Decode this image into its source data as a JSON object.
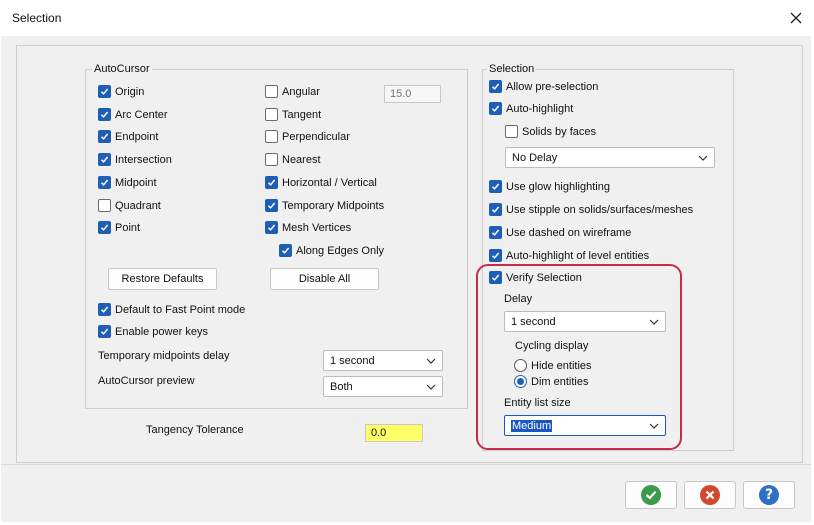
{
  "window": {
    "title": "Selection"
  },
  "autocursor": {
    "group_label": "AutoCursor",
    "col1": [
      {
        "label": "Origin",
        "checked": true
      },
      {
        "label": "Arc Center",
        "checked": true
      },
      {
        "label": "Endpoint",
        "checked": true
      },
      {
        "label": "Intersection",
        "checked": true
      },
      {
        "label": "Midpoint",
        "checked": true
      },
      {
        "label": "Quadrant",
        "checked": false
      },
      {
        "label": "Point",
        "checked": true
      }
    ],
    "col2": [
      {
        "label": "Angular",
        "checked": false
      },
      {
        "label": "Tangent",
        "checked": false
      },
      {
        "label": "Perpendicular",
        "checked": false
      },
      {
        "label": "Nearest",
        "checked": false
      },
      {
        "label": "Horizontal / Vertical",
        "checked": true
      },
      {
        "label": "Temporary Midpoints",
        "checked": true
      },
      {
        "label": "Mesh Vertices",
        "checked": true
      }
    ],
    "along_edges": {
      "label": "Along Edges Only",
      "checked": true
    },
    "angle_value": "15.0",
    "restore_defaults": "Restore Defaults",
    "disable_all": "Disable All",
    "fast_point": {
      "label": "Default to Fast Point mode",
      "checked": true
    },
    "power_keys": {
      "label": "Enable power keys",
      "checked": true
    },
    "temp_midpoints_delay_label": "Temporary midpoints delay",
    "temp_midpoints_delay_value": "1 second",
    "preview_label": "AutoCursor preview",
    "preview_value": "Both"
  },
  "tangency": {
    "label": "Tangency Tolerance",
    "value": "0.0"
  },
  "selection": {
    "group_label": "Selection",
    "allow_preselection": {
      "label": "Allow pre-selection",
      "checked": true
    },
    "auto_highlight": {
      "label": "Auto-highlight",
      "checked": true
    },
    "solids_by_faces": {
      "label": "Solids by faces",
      "checked": false
    },
    "delay_value": "No Delay",
    "glow": {
      "label": "Use glow highlighting",
      "checked": true
    },
    "stipple": {
      "label": "Use stipple on solids/surfaces/meshes",
      "checked": true
    },
    "dashed": {
      "label": "Use dashed on wireframe",
      "checked": true
    },
    "level_entities": {
      "label": "Auto-highlight of level entities",
      "checked": true
    },
    "verify": {
      "label": "Verify Selection",
      "checked": true
    },
    "delay_label": "Delay",
    "verify_delay_value": "1 second",
    "cycling_label": "Cycling display",
    "hide_entities": {
      "label": "Hide entities",
      "selected": false
    },
    "dim_entities": {
      "label": "Dim entities",
      "selected": true
    },
    "entity_list_label": "Entity list size",
    "entity_list_value": "Medium"
  },
  "footer": {
    "ok_icon": "checkmark-icon",
    "cancel_icon": "x-cancel-icon",
    "help_icon": "question-help-icon",
    "colors": {
      "ok": "#3c9a4a",
      "cancel": "#d0492e",
      "help": "#2f6fc4"
    }
  },
  "colors": {
    "accent": "#1f5eb5",
    "highlight_ring": "#c52c4a",
    "tolerance_bg": "#ffff66"
  }
}
